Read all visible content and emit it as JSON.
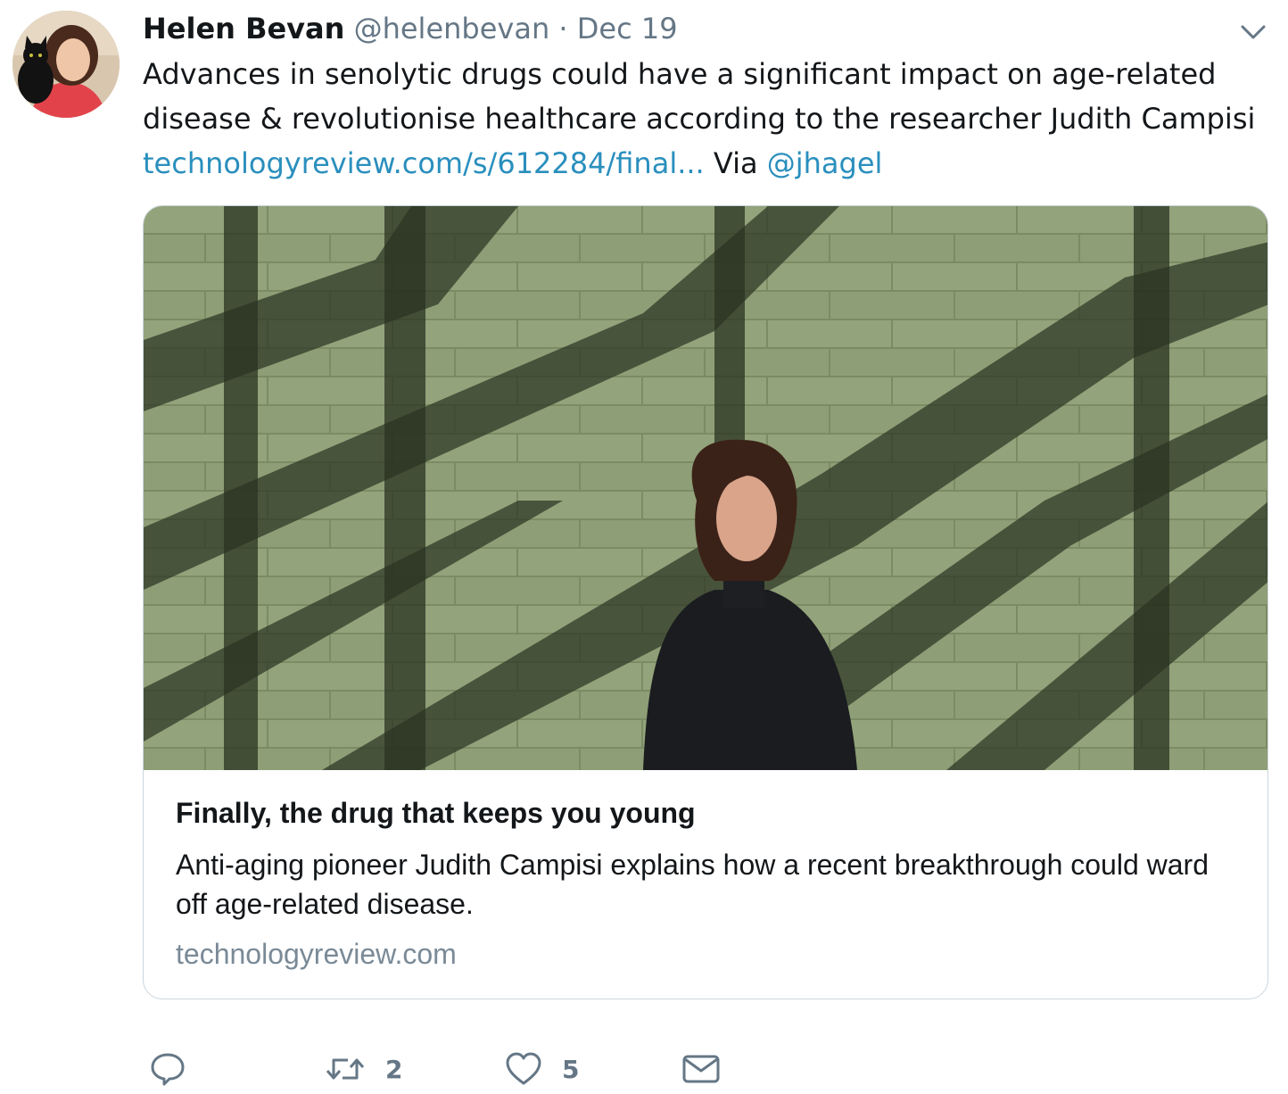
{
  "tweet": {
    "author_name": "Helen Bevan",
    "author_handle": "@helenbevan",
    "separator": "·",
    "date": "Dec 19",
    "text_line1": "Advances in senolytic drugs  could have a significant impact on age-related",
    "text_line2": "disease & revolutionise healthcare according to the researcher Judith Campisi",
    "link_text": "technologyreview.com/s/612284/final...",
    "via_text": " Via ",
    "mention": "@jhagel"
  },
  "card": {
    "title": "Finally, the drug that keeps you young",
    "description": "Anti-aging pioneer Judith Campisi explains how a recent breakthrough could ward off age-related disease.",
    "domain": "technologyreview.com"
  },
  "actions": {
    "reply_icon": "reply-icon",
    "retweet_icon": "retweet-icon",
    "retweet_count": "2",
    "like_icon": "heart-icon",
    "like_count": "5",
    "message_icon": "envelope-icon"
  },
  "colors": {
    "link": "#2a8fbd",
    "muted": "#657786",
    "text": "#14171a",
    "border": "#ccd6dd"
  }
}
